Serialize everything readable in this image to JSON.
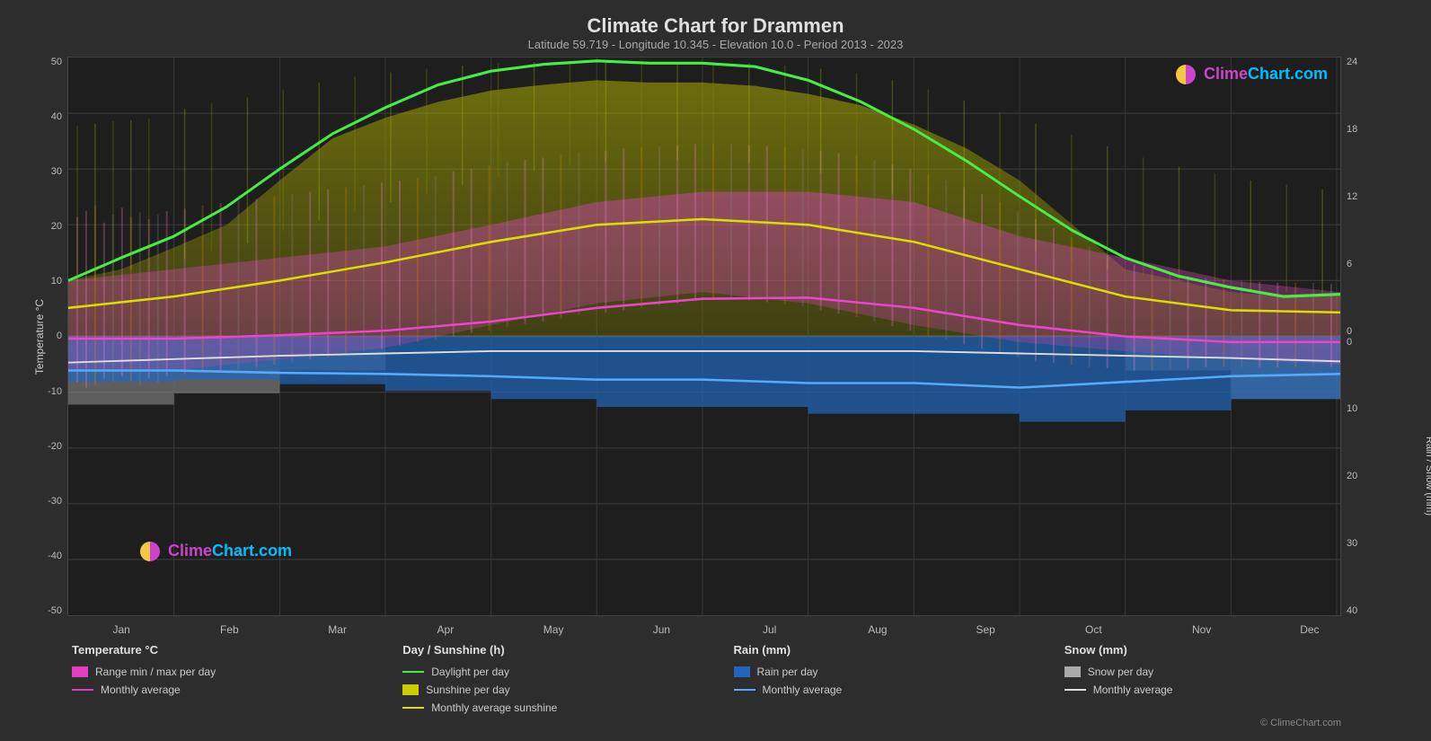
{
  "title": "Climate Chart for Drammen",
  "subtitle": "Latitude 59.719 - Longitude 10.345 - Elevation 10.0 - Period 2013 - 2023",
  "watermark": "ClimeChart.com",
  "copyright": "© ClimeChart.com",
  "x_axis": {
    "months": [
      "Jan",
      "Feb",
      "Mar",
      "Apr",
      "May",
      "Jun",
      "Jul",
      "Aug",
      "Sep",
      "Oct",
      "Nov",
      "Dec"
    ]
  },
  "y_axis_left": {
    "label": "Temperature °C",
    "values": [
      "50",
      "40",
      "30",
      "20",
      "10",
      "0",
      "-10",
      "-20",
      "-30",
      "-40",
      "-50"
    ]
  },
  "y_axis_right_top": {
    "label": "Day / Sunshine (h)",
    "values": [
      "24",
      "18",
      "12",
      "6",
      "0"
    ]
  },
  "y_axis_right_bottom": {
    "label": "Rain / Snow (mm)",
    "values": [
      "0",
      "10",
      "20",
      "30",
      "40"
    ]
  },
  "legend": {
    "temperature": {
      "title": "Temperature °C",
      "items": [
        {
          "type": "swatch",
          "color": "#e040c0",
          "label": "Range min / max per day"
        },
        {
          "type": "line",
          "color": "#e040c0",
          "label": "Monthly average"
        }
      ]
    },
    "sunshine": {
      "title": "Day / Sunshine (h)",
      "items": [
        {
          "type": "line",
          "color": "#44cc44",
          "label": "Daylight per day"
        },
        {
          "type": "swatch",
          "color": "#c8cc00",
          "label": "Sunshine per day"
        },
        {
          "type": "line",
          "color": "#c8cc00",
          "label": "Monthly average sunshine"
        }
      ]
    },
    "rain": {
      "title": "Rain (mm)",
      "items": [
        {
          "type": "swatch",
          "color": "#3399ff",
          "label": "Rain per day"
        },
        {
          "type": "line",
          "color": "#44aaff",
          "label": "Monthly average"
        }
      ]
    },
    "snow": {
      "title": "Snow (mm)",
      "items": [
        {
          "type": "swatch",
          "color": "#aaaaaa",
          "label": "Snow per day"
        },
        {
          "type": "line",
          "color": "#bbbbbb",
          "label": "Monthly average"
        }
      ]
    }
  }
}
